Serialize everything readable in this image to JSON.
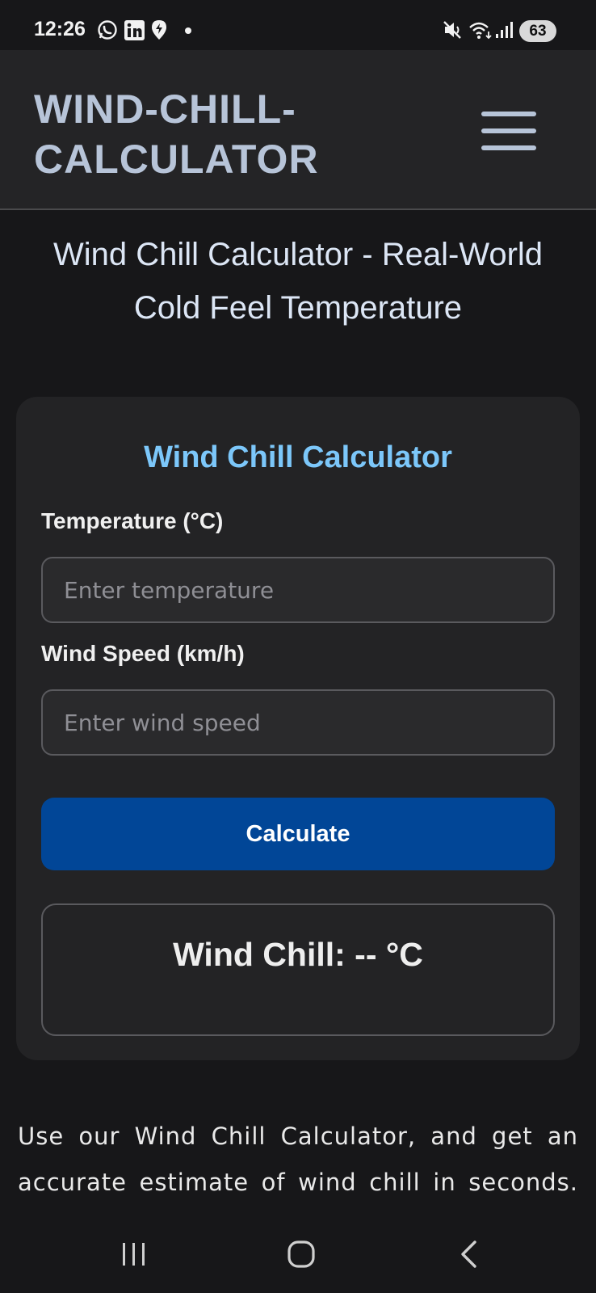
{
  "status_bar": {
    "time": "12:26",
    "battery": "63",
    "icons": [
      "whatsapp-icon",
      "linkedin-icon",
      "location-pin-icon",
      "notification-dot",
      "mute-icon",
      "wifi-icon",
      "signal-icon",
      "battery-icon"
    ]
  },
  "header": {
    "brand": "WIND-CHILL-CALCULATOR",
    "menu_icon": "hamburger-menu-icon"
  },
  "page": {
    "title": "Wind Chill Calculator - Real-World Cold Feel Temperature"
  },
  "calculator": {
    "title": "Wind Chill Calculator",
    "temperature": {
      "label": "Temperature (°C)",
      "value": "",
      "placeholder": "Enter temperature"
    },
    "wind_speed": {
      "label": "Wind Speed (km/h)",
      "value": "",
      "placeholder": "Enter wind speed"
    },
    "button_label": "Calculate",
    "result": "Wind Chill: -- °C"
  },
  "intro_text": "Use our Wind Chill Calculator, and get an accurate estimate of wind chill in seconds.",
  "colors": {
    "background": "#171719",
    "header": "#242426",
    "card": "#232325",
    "accent_title": "#7cc7fa",
    "button": "#014697"
  },
  "nav_bar": {
    "icons": [
      "recent-apps-icon",
      "home-icon",
      "back-icon"
    ]
  }
}
